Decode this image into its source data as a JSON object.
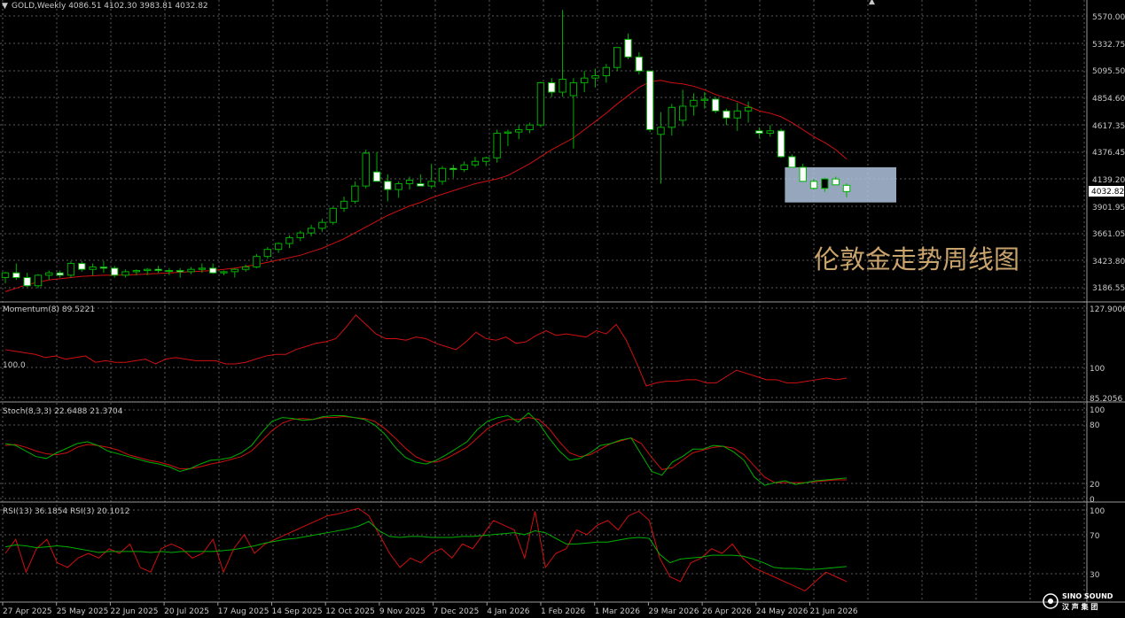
{
  "window": {
    "symbol_header": "GOLD,Weekly  4086.51 4102.30 3983.81 4032.82",
    "current_price": "4032.82",
    "annotation": "伦敦金走势周线图",
    "logo_name": "SINO SOUND",
    "logo_cn": "汉 声 集 团",
    "colors": {
      "background": "#000000",
      "bull": "#00b000",
      "bear": "#ffffff",
      "ma": "#d01010",
      "grid": "#5a5a5a",
      "highlight": "#b0c4de",
      "annotation": "#c9a36c"
    }
  },
  "panes": {
    "price": {
      "axis_labels": [
        "5570.00",
        "5332.75",
        "5095.50",
        "4854.60",
        "4617.35",
        "4376.45",
        "4139.20",
        "3901.95",
        "3661.05",
        "3423.80",
        "3186.55"
      ]
    },
    "momentum": {
      "title": "Momentum(8) 89.5221",
      "left_level": "100.0",
      "axis_labels": [
        "127.9006",
        "100",
        "85.2056"
      ]
    },
    "stoch": {
      "title": "Stoch(8,3,3) 22.6488 21.3704",
      "axis_labels": [
        "100",
        "80",
        "20",
        "0"
      ]
    },
    "rsi": {
      "title": "RSI(13) 36.1854  RSI(3) 20.1012",
      "axis_labels": [
        "100",
        "70",
        "30"
      ]
    }
  },
  "chart_data": {
    "type": "candlestick",
    "title": "GOLD,Weekly",
    "x_labels": [
      "27 Apr 2025",
      "25 May 2025",
      "22 Jun 2025",
      "20 Jul 2025",
      "17 Aug 2025",
      "14 Sep 2025",
      "12 Oct 2025",
      "9 Nov 2025",
      "7 Dec 2025",
      "4 Jan 2026",
      "1 Feb 2026",
      "1 Mar 2026",
      "29 Mar 2026",
      "26 Apr 2026",
      "24 May 2026",
      "21 Jun 2026"
    ],
    "ylim": [
      3100,
      5650
    ],
    "candles": [
      [
        3300,
        3350,
        3250,
        3340
      ],
      [
        3340,
        3420,
        3280,
        3300
      ],
      [
        3300,
        3340,
        3220,
        3230
      ],
      [
        3230,
        3330,
        3210,
        3320
      ],
      [
        3320,
        3360,
        3280,
        3340
      ],
      [
        3340,
        3360,
        3300,
        3320
      ],
      [
        3320,
        3440,
        3300,
        3420
      ],
      [
        3420,
        3440,
        3350,
        3370
      ],
      [
        3370,
        3420,
        3320,
        3390
      ],
      [
        3390,
        3440,
        3340,
        3380
      ],
      [
        3380,
        3400,
        3300,
        3320
      ],
      [
        3320,
        3370,
        3300,
        3350
      ],
      [
        3350,
        3370,
        3320,
        3360
      ],
      [
        3360,
        3380,
        3320,
        3370
      ],
      [
        3370,
        3400,
        3340,
        3360
      ],
      [
        3360,
        3380,
        3320,
        3360
      ],
      [
        3360,
        3380,
        3300,
        3350
      ],
      [
        3350,
        3390,
        3330,
        3370
      ],
      [
        3370,
        3420,
        3340,
        3380
      ],
      [
        3380,
        3420,
        3330,
        3340
      ],
      [
        3340,
        3360,
        3320,
        3350
      ],
      [
        3350,
        3380,
        3300,
        3370
      ],
      [
        3370,
        3410,
        3350,
        3390
      ],
      [
        3390,
        3500,
        3380,
        3480
      ],
      [
        3480,
        3560,
        3460,
        3540
      ],
      [
        3540,
        3600,
        3510,
        3590
      ],
      [
        3590,
        3660,
        3550,
        3640
      ],
      [
        3640,
        3700,
        3610,
        3680
      ],
      [
        3680,
        3750,
        3650,
        3720
      ],
      [
        3720,
        3800,
        3690,
        3770
      ],
      [
        3770,
        3900,
        3750,
        3890
      ],
      [
        3890,
        3990,
        3860,
        3950
      ],
      [
        3950,
        4120,
        3930,
        4080
      ],
      [
        4080,
        4390,
        4060,
        4360
      ],
      [
        4200,
        4370,
        4120,
        4120
      ],
      [
        4120,
        4180,
        3950,
        4050
      ],
      [
        4050,
        4120,
        3980,
        4100
      ],
      [
        4100,
        4160,
        4050,
        4130
      ],
      [
        4100,
        4180,
        4080,
        4080
      ],
      [
        4080,
        4270,
        4060,
        4120
      ],
      [
        4120,
        4250,
        4090,
        4230
      ],
      [
        4230,
        4260,
        4150,
        4220
      ],
      [
        4220,
        4290,
        4200,
        4260
      ],
      [
        4260,
        4330,
        4240,
        4290
      ],
      [
        4290,
        4330,
        4250,
        4320
      ],
      [
        4320,
        4560,
        4280,
        4530
      ],
      [
        4530,
        4560,
        4420,
        4540
      ],
      [
        4540,
        4600,
        4480,
        4560
      ],
      [
        4560,
        4620,
        4530,
        4600
      ],
      [
        4600,
        4970,
        4580,
        4960
      ],
      [
        4960,
        5000,
        4840,
        4880
      ],
      [
        4880,
        5580,
        4840,
        4990
      ],
      [
        4850,
        5000,
        4400,
        4960
      ],
      [
        4960,
        5060,
        4880,
        5000
      ],
      [
        5000,
        5080,
        4920,
        5020
      ],
      [
        5020,
        5120,
        4960,
        5090
      ],
      [
        5090,
        5260,
        5060,
        5260
      ],
      [
        5330,
        5380,
        5160,
        5180
      ],
      [
        5180,
        5220,
        5030,
        5060
      ],
      [
        5060,
        5060,
        4540,
        4560
      ],
      [
        4520,
        4710,
        4100,
        4580
      ],
      [
        4580,
        4780,
        4510,
        4750
      ],
      [
        4640,
        4900,
        4590,
        4760
      ],
      [
        4760,
        4870,
        4680,
        4810
      ],
      [
        4810,
        4880,
        4740,
        4820
      ],
      [
        4820,
        4840,
        4700,
        4720
      ],
      [
        4720,
        4740,
        4600,
        4660
      ],
      [
        4660,
        4790,
        4550,
        4720
      ],
      [
        4720,
        4800,
        4620,
        4750
      ],
      [
        4550,
        4580,
        4490,
        4530
      ],
      [
        4530,
        4600,
        4500,
        4550
      ],
      [
        4550,
        4570,
        4320,
        4330
      ],
      [
        4330,
        4350,
        4240,
        4240
      ],
      [
        4240,
        4270,
        4120,
        4120
      ],
      [
        4120,
        4140,
        4050,
        4060
      ],
      [
        4060,
        4150,
        4030,
        4140
      ],
      [
        4140,
        4160,
        4090,
        4090
      ],
      [
        4086,
        4102,
        3984,
        4033
      ]
    ],
    "ma": [
      3180,
      3210,
      3240,
      3260,
      3280,
      3290,
      3300,
      3310,
      3315,
      3320,
      3320,
      3322,
      3325,
      3330,
      3335,
      3340,
      3345,
      3350,
      3355,
      3360,
      3370,
      3380,
      3395,
      3410,
      3430,
      3450,
      3470,
      3490,
      3520,
      3550,
      3590,
      3630,
      3680,
      3730,
      3780,
      3830,
      3870,
      3910,
      3940,
      3980,
      4010,
      4040,
      4070,
      4100,
      4120,
      4140,
      4170,
      4220,
      4270,
      4330,
      4390,
      4440,
      4490,
      4560,
      4630,
      4700,
      4780,
      4850,
      4920,
      4970,
      4980,
      4960,
      4950,
      4930,
      4900,
      4860,
      4830,
      4800,
      4760,
      4720,
      4700,
      4670,
      4620,
      4560,
      4500,
      4450,
      4390,
      4310
    ],
    "momentum": {
      "ylim": [
        75,
        135
      ],
      "values": [
        107,
        106,
        105,
        104,
        102,
        103,
        101,
        102,
        103,
        99,
        100,
        99,
        99,
        100,
        101,
        98,
        101,
        102,
        101,
        100,
        100,
        100,
        98,
        98,
        99,
        101,
        103,
        104,
        104,
        107,
        109,
        111,
        112,
        114,
        121,
        129,
        123,
        117,
        114,
        114,
        113,
        115,
        114,
        111,
        109,
        107,
        112,
        118,
        114,
        113,
        115,
        111,
        112,
        116,
        119,
        116,
        117,
        116,
        115,
        119,
        117,
        123,
        113,
        99,
        84,
        86,
        87,
        87,
        88,
        88,
        86,
        86,
        90,
        94,
        92,
        90,
        88,
        88,
        86,
        86,
        87,
        88,
        89,
        88,
        89
      ]
    },
    "stoch": {
      "ylim": [
        0,
        100
      ],
      "main": [
        60,
        58,
        52,
        46,
        44,
        50,
        55,
        60,
        62,
        58,
        52,
        49,
        46,
        43,
        40,
        38,
        35,
        30,
        33,
        38,
        42,
        43,
        45,
        50,
        58,
        72,
        84,
        88,
        87,
        85,
        86,
        89,
        90,
        90,
        88,
        86,
        80,
        70,
        56,
        45,
        40,
        38,
        42,
        48,
        55,
        62,
        75,
        84,
        88,
        90,
        83,
        93,
        82,
        66,
        52,
        42,
        44,
        50,
        58,
        60,
        64,
        66,
        48,
        30,
        26,
        40,
        46,
        54,
        54,
        58,
        57,
        51,
        42,
        24,
        15,
        18,
        20,
        16,
        18,
        20,
        21,
        22,
        23
      ],
      "signal": [
        58,
        59,
        56,
        52,
        49,
        48,
        50,
        56,
        59,
        58,
        56,
        53,
        48,
        45,
        42,
        40,
        37,
        33,
        33,
        35,
        38,
        40,
        43,
        46,
        52,
        63,
        74,
        82,
        86,
        87,
        86,
        88,
        88,
        89,
        88,
        87,
        84,
        76,
        66,
        55,
        46,
        41,
        40,
        44,
        50,
        56,
        66,
        76,
        82,
        86,
        86,
        88,
        86,
        76,
        62,
        50,
        46,
        48,
        54,
        60,
        63,
        66,
        60,
        45,
        32,
        34,
        42,
        50,
        53,
        56,
        57,
        55,
        48,
        36,
        24,
        18,
        18,
        18,
        18,
        19,
        20,
        21,
        21
      ]
    },
    "rsi": {
      "ylim": [
        0,
        100
      ],
      "rsi13": [
        57,
        59,
        58,
        56,
        57,
        58,
        57,
        55,
        53,
        51,
        52,
        52,
        52,
        52,
        51,
        52,
        51,
        52,
        52,
        52,
        52,
        53,
        54,
        56,
        58,
        61,
        63,
        65,
        66,
        68,
        70,
        72,
        74,
        76,
        79,
        84,
        74,
        68,
        67,
        68,
        68,
        67,
        67,
        67,
        68,
        68,
        69,
        70,
        71,
        72,
        70,
        74,
        72,
        66,
        60,
        60,
        61,
        62,
        62,
        64,
        66,
        67,
        66,
        49,
        40,
        44,
        45,
        46,
        48,
        48,
        48,
        47,
        44,
        40,
        35,
        34,
        34,
        33,
        33,
        34,
        35,
        36
      ],
      "rsi3": [
        50,
        65,
        30,
        55,
        65,
        40,
        35,
        45,
        50,
        45,
        55,
        50,
        60,
        35,
        30,
        55,
        60,
        55,
        45,
        50,
        65,
        30,
        55,
        70,
        50,
        60,
        65,
        70,
        75,
        80,
        85,
        90,
        92,
        95,
        98,
        90,
        70,
        50,
        35,
        45,
        40,
        50,
        55,
        45,
        60,
        55,
        70,
        85,
        80,
        75,
        45,
        95,
        35,
        50,
        55,
        75,
        70,
        80,
        85,
        75,
        90,
        95,
        85,
        45,
        25,
        20,
        40,
        45,
        55,
        50,
        60,
        45,
        35,
        30,
        25,
        20,
        15,
        10,
        20,
        30,
        25,
        20
      ]
    }
  }
}
